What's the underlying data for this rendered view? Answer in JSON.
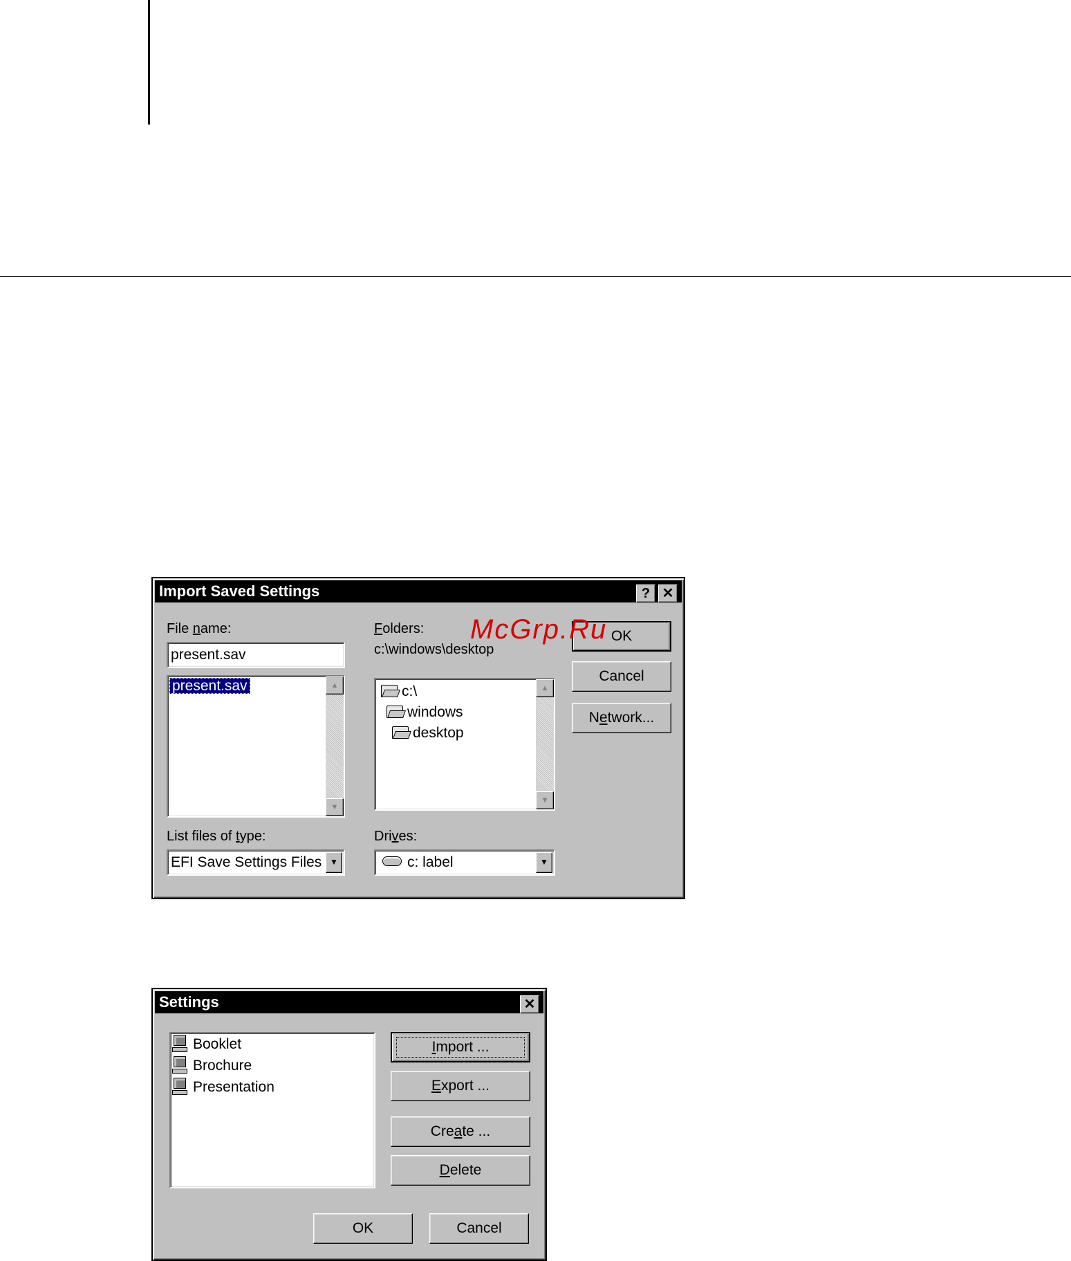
{
  "watermark": "McGrp.Ru",
  "import_dialog": {
    "title": "Import Saved Settings",
    "help_button": "?",
    "close_button": "✕",
    "file_name": {
      "label_pre": "File ",
      "label_ul": "n",
      "label_post": "ame:",
      "value": "present.sav"
    },
    "file_list": [
      "present.sav"
    ],
    "folders": {
      "label_ul": "F",
      "label_post": "olders:",
      "path": "c:\\windows\\desktop",
      "items": [
        "c:\\",
        "windows",
        "desktop"
      ]
    },
    "list_type": {
      "label_pre": "List files of ",
      "label_ul": "t",
      "label_post": "ype:",
      "value": "EFI Save Settings Files"
    },
    "drives": {
      "label_pre": "Dri",
      "label_ul": "v",
      "label_post": "es:",
      "value": "c: label"
    },
    "buttons": {
      "ok": "OK",
      "cancel": "Cancel",
      "network_pre": "N",
      "network_ul": "e",
      "network_post": "twork..."
    }
  },
  "settings_dialog": {
    "title": "Settings",
    "close_button": "✕",
    "items": [
      "Booklet",
      "Brochure",
      "Presentation"
    ],
    "buttons": {
      "import_ul": "I",
      "import_post": "mport ...",
      "export_ul": "E",
      "export_post": "xport ...",
      "create_pre": "Cre",
      "create_ul": "a",
      "create_post": "te ...",
      "delete_ul": "D",
      "delete_post": "elete",
      "ok": "OK",
      "cancel": "Cancel"
    }
  }
}
